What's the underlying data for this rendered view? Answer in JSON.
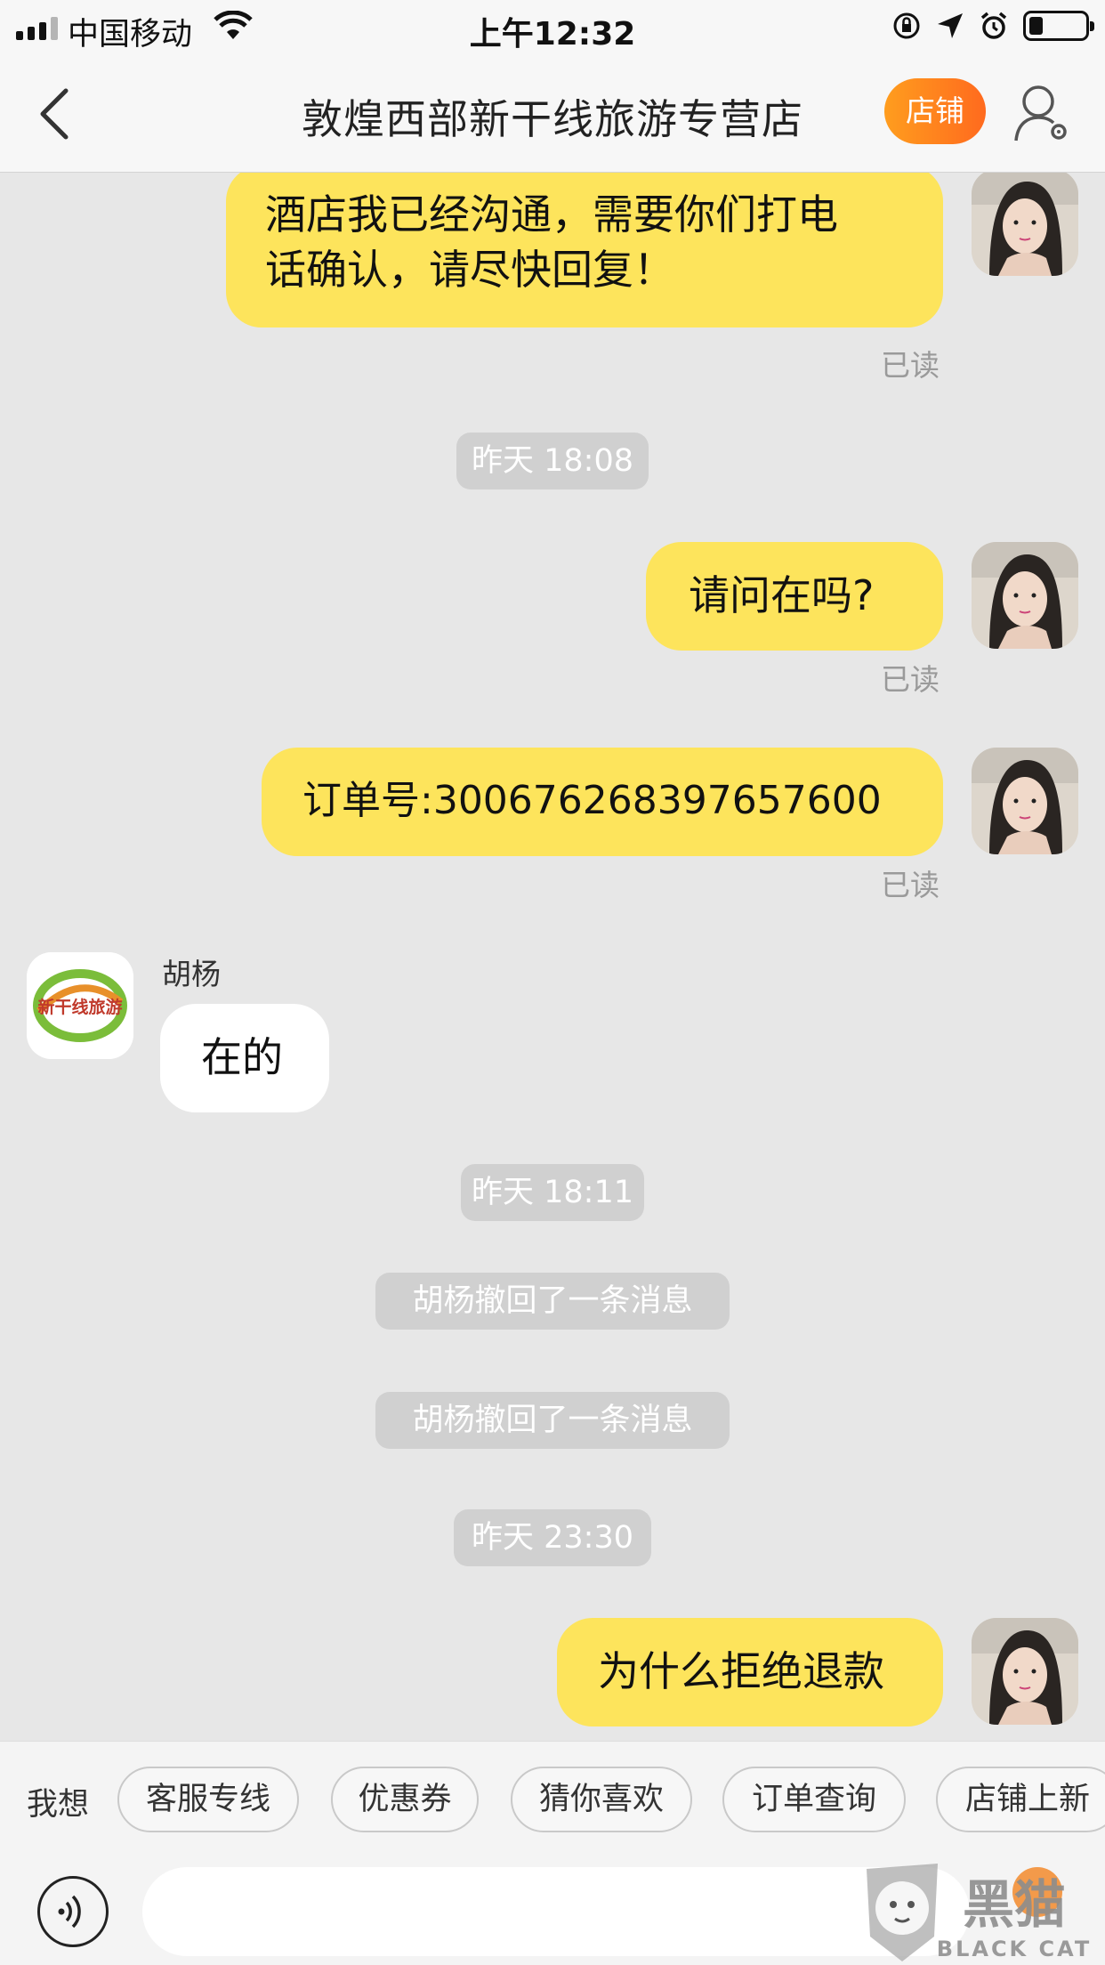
{
  "status_bar": {
    "carrier": "中国移动",
    "time": "上午12:32",
    "battery_level_percent": 25
  },
  "nav": {
    "title": "敦煌西部新干线旅游专营店",
    "shop_button": "店铺",
    "back_icon": "chevron-left-icon",
    "user_icon": "user-settings-icon"
  },
  "messages": [
    {
      "type": "outgoing",
      "text_line1": "酒店我已经沟通，需要你们打电",
      "text_line2": "话确认，请尽快回复！",
      "read": "已读"
    },
    {
      "type": "time",
      "text": "昨天 18:08"
    },
    {
      "type": "outgoing",
      "text": "请问在吗?",
      "read": "已读"
    },
    {
      "type": "outgoing",
      "text": "订单号:3006762683976576​00",
      "read": "已读"
    },
    {
      "type": "incoming",
      "sender": "胡杨",
      "avatar_text": "新干线旅游",
      "text": "在的"
    },
    {
      "type": "time",
      "text": "昨天 18:11"
    },
    {
      "type": "system",
      "text": "胡杨撤回了一条消息"
    },
    {
      "type": "system",
      "text": "胡杨撤回了一条消息"
    },
    {
      "type": "time",
      "text": "昨天 23:30"
    },
    {
      "type": "outgoing",
      "text": "为什么拒绝退款"
    }
  ],
  "quick_actions": {
    "label": "我想",
    "chips": [
      "客服专线",
      "优惠券",
      "猜你喜欢",
      "订单查询",
      "店铺上新"
    ]
  },
  "input": {
    "placeholder": "",
    "voice_icon": "voice-icon"
  },
  "watermark": {
    "text": "黑猫",
    "subtext": "BLACK CAT"
  },
  "colors": {
    "outgoing_bubble": "#fde45c",
    "incoming_bubble": "#ffffff",
    "shop_button": "#ff7a1e",
    "background": "#e7e7e7"
  }
}
